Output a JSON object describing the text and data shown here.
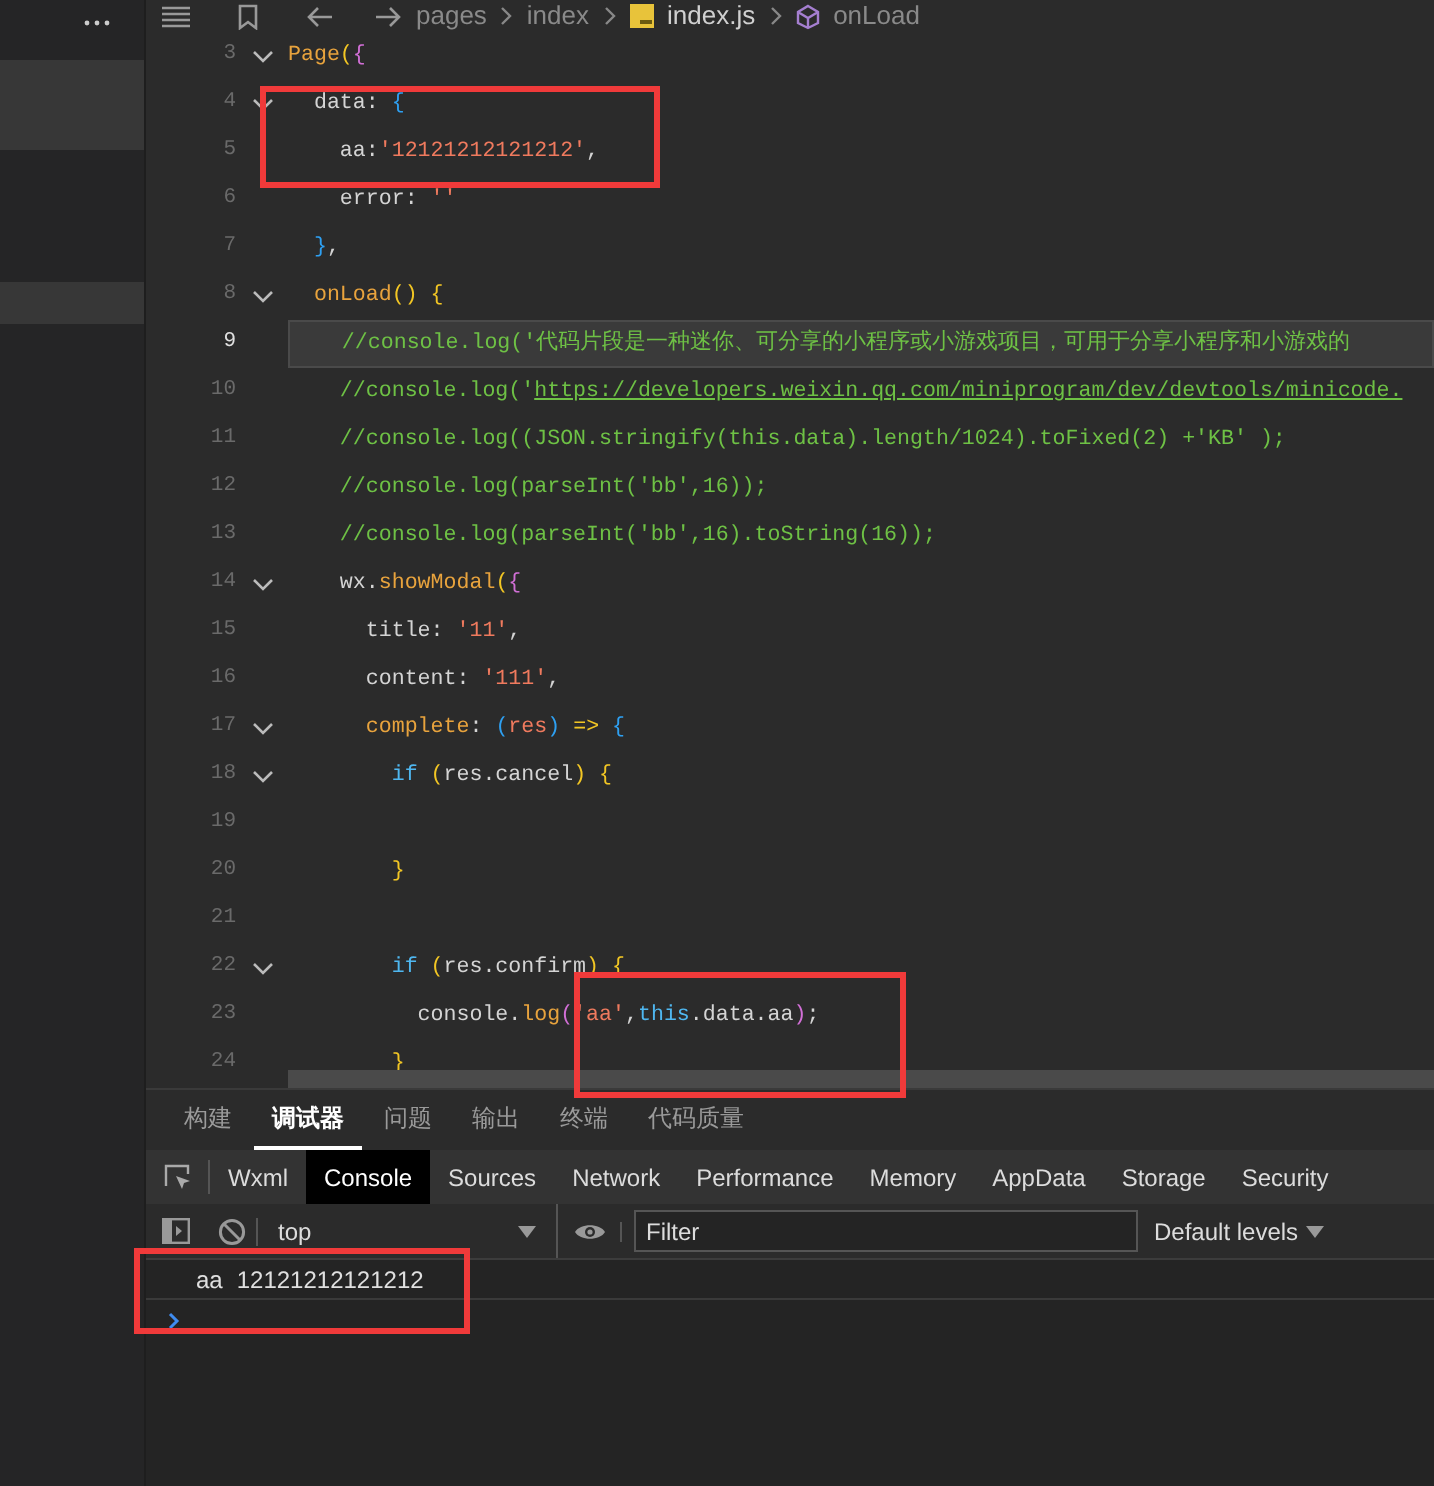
{
  "breadcrumb": {
    "parts": [
      {
        "kind": "folder",
        "text": "pages"
      },
      {
        "kind": "folder",
        "text": "index"
      },
      {
        "kind": "file",
        "text": "index.js"
      },
      {
        "kind": "symbol",
        "text": "onLoad"
      }
    ]
  },
  "editor": {
    "lines": [
      {
        "number": "3",
        "foldable": true,
        "current": false,
        "tokens": [
          {
            "kind": "fn",
            "text": "Page"
          },
          {
            "kind": "b1",
            "text": "("
          },
          {
            "kind": "b2",
            "text": "{"
          }
        ]
      },
      {
        "number": "4",
        "foldable": true,
        "current": false,
        "tokens": [
          {
            "kind": "plain",
            "text": "  data: "
          },
          {
            "kind": "b3",
            "text": "{"
          }
        ]
      },
      {
        "number": "5",
        "foldable": false,
        "current": false,
        "tokens": [
          {
            "kind": "plain",
            "text": "    aa:"
          },
          {
            "kind": "str",
            "text": "'12121212121212'"
          },
          {
            "kind": "plain",
            "text": ","
          }
        ]
      },
      {
        "number": "6",
        "foldable": false,
        "current": false,
        "tokens": [
          {
            "kind": "plain",
            "text": "    error: "
          },
          {
            "kind": "str",
            "text": "''"
          }
        ]
      },
      {
        "number": "7",
        "foldable": false,
        "current": false,
        "tokens": [
          {
            "kind": "b3",
            "text": "  }"
          },
          {
            "kind": "plain",
            "text": ","
          }
        ]
      },
      {
        "number": "8",
        "foldable": true,
        "current": false,
        "tokens": [
          {
            "kind": "fn",
            "text": "  onLoad"
          },
          {
            "kind": "b1",
            "text": "() {"
          }
        ]
      },
      {
        "number": "9",
        "foldable": false,
        "current": true,
        "tokens": [
          {
            "kind": "comment",
            "text": "    //console.log('代码片段是一种迷你、可分享的小程序或小游戏项目，可用于分享小程序和小游戏的"
          }
        ]
      },
      {
        "number": "10",
        "foldable": false,
        "current": false,
        "tokens": [
          {
            "kind": "comment",
            "text": "    //console.log('"
          },
          {
            "kind": "link",
            "text": "https://developers.weixin.qq.com/miniprogram/dev/devtools/minicode."
          }
        ]
      },
      {
        "number": "11",
        "foldable": false,
        "current": false,
        "tokens": [
          {
            "kind": "comment",
            "text": "    //console.log((JSON.stringify(this.data).length/1024).toFixed(2) +'KB' );"
          }
        ]
      },
      {
        "number": "12",
        "foldable": false,
        "current": false,
        "tokens": [
          {
            "kind": "comment",
            "text": "    //console.log(parseInt('bb',16));"
          }
        ]
      },
      {
        "number": "13",
        "foldable": false,
        "current": false,
        "tokens": [
          {
            "kind": "comment",
            "text": "    //console.log(parseInt('bb',16).toString(16));"
          }
        ]
      },
      {
        "number": "14",
        "foldable": true,
        "current": false,
        "tokens": [
          {
            "kind": "plain",
            "text": "    wx."
          },
          {
            "kind": "fn",
            "text": "showModal"
          },
          {
            "kind": "b1",
            "text": "("
          },
          {
            "kind": "b2",
            "text": "{"
          }
        ]
      },
      {
        "number": "15",
        "foldable": false,
        "current": false,
        "tokens": [
          {
            "kind": "plain",
            "text": "      title: "
          },
          {
            "kind": "str",
            "text": "'11'"
          },
          {
            "kind": "plain",
            "text": ","
          }
        ]
      },
      {
        "number": "16",
        "foldable": false,
        "current": false,
        "tokens": [
          {
            "kind": "plain",
            "text": "      content: "
          },
          {
            "kind": "str",
            "text": "'111'"
          },
          {
            "kind": "plain",
            "text": ","
          }
        ]
      },
      {
        "number": "17",
        "foldable": true,
        "current": false,
        "tokens": [
          {
            "kind": "fn",
            "text": "      complete"
          },
          {
            "kind": "plain",
            "text": ": "
          },
          {
            "kind": "b3",
            "text": "("
          },
          {
            "kind": "str",
            "text": "res"
          },
          {
            "kind": "b3",
            "text": ")"
          },
          {
            "kind": "b1",
            "text": " => "
          },
          {
            "kind": "b3",
            "text": "{"
          }
        ]
      },
      {
        "number": "18",
        "foldable": true,
        "current": false,
        "tokens": [
          {
            "kind": "keyword",
            "text": "        if"
          },
          {
            "kind": "b1",
            "text": " ("
          },
          {
            "kind": "plain",
            "text": "res.cancel"
          },
          {
            "kind": "b1",
            "text": ") {"
          }
        ]
      },
      {
        "number": "19",
        "foldable": false,
        "current": false
      },
      {
        "number": "20",
        "foldable": false,
        "current": false,
        "tokens": [
          {
            "kind": "b1",
            "text": "        }"
          }
        ]
      },
      {
        "number": "21",
        "foldable": false,
        "current": false
      },
      {
        "number": "22",
        "foldable": true,
        "current": false,
        "tokens": [
          {
            "kind": "keyword",
            "text": "        if"
          },
          {
            "kind": "b1",
            "text": " ("
          },
          {
            "kind": "plain",
            "text": "res.confirm"
          },
          {
            "kind": "b1",
            "text": ") {"
          }
        ]
      },
      {
        "number": "23",
        "foldable": false,
        "current": false,
        "tokens": [
          {
            "kind": "plain",
            "text": "          console."
          },
          {
            "kind": "fn",
            "text": "log"
          },
          {
            "kind": "b2",
            "text": "("
          },
          {
            "kind": "str",
            "text": "'aa'"
          },
          {
            "kind": "plain",
            "text": ","
          },
          {
            "kind": "keyword",
            "text": "this"
          },
          {
            "kind": "plain",
            "text": ".data.aa"
          },
          {
            "kind": "b2",
            "text": ")"
          },
          {
            "kind": "plain",
            "text": ";"
          }
        ]
      },
      {
        "number": "24",
        "foldable": false,
        "current": false,
        "tokens": [
          {
            "kind": "b1",
            "text": "        }"
          }
        ]
      }
    ]
  },
  "panel_tabs": [
    {
      "label": "构建",
      "selected": false
    },
    {
      "label": "调试器",
      "selected": true
    },
    {
      "label": "问题",
      "selected": false
    },
    {
      "label": "输出",
      "selected": false
    },
    {
      "label": "终端",
      "selected": false
    },
    {
      "label": "代码质量",
      "selected": false
    }
  ],
  "devtools_tabs": [
    {
      "label": "Wxml",
      "selected": false
    },
    {
      "label": "Console",
      "selected": true
    },
    {
      "label": "Sources",
      "selected": false
    },
    {
      "label": "Network",
      "selected": false
    },
    {
      "label": "Performance",
      "selected": false
    },
    {
      "label": "Memory",
      "selected": false
    },
    {
      "label": "AppData",
      "selected": false
    },
    {
      "label": "Storage",
      "selected": false
    },
    {
      "label": "Security",
      "selected": false
    }
  ],
  "console_toolbar": {
    "context": "top",
    "filter": {
      "placeholder": "Filter"
    },
    "levels": "Default levels"
  },
  "console_messages": [
    {
      "label": "aa",
      "value": "12121212121212"
    }
  ]
}
